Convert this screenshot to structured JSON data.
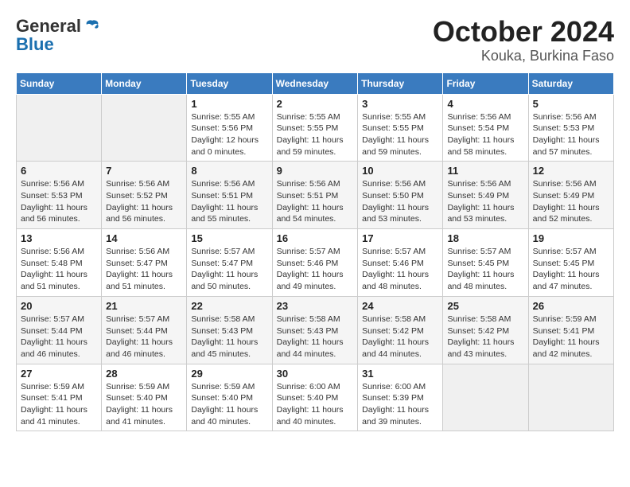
{
  "header": {
    "logo_line1": "General",
    "logo_line2": "Blue",
    "month": "October 2024",
    "location": "Kouka, Burkina Faso"
  },
  "weekdays": [
    "Sunday",
    "Monday",
    "Tuesday",
    "Wednesday",
    "Thursday",
    "Friday",
    "Saturday"
  ],
  "weeks": [
    [
      {
        "day": "",
        "info": ""
      },
      {
        "day": "",
        "info": ""
      },
      {
        "day": "1",
        "info": "Sunrise: 5:55 AM\nSunset: 5:56 PM\nDaylight: 12 hours\nand 0 minutes."
      },
      {
        "day": "2",
        "info": "Sunrise: 5:55 AM\nSunset: 5:55 PM\nDaylight: 11 hours\nand 59 minutes."
      },
      {
        "day": "3",
        "info": "Sunrise: 5:55 AM\nSunset: 5:55 PM\nDaylight: 11 hours\nand 59 minutes."
      },
      {
        "day": "4",
        "info": "Sunrise: 5:56 AM\nSunset: 5:54 PM\nDaylight: 11 hours\nand 58 minutes."
      },
      {
        "day": "5",
        "info": "Sunrise: 5:56 AM\nSunset: 5:53 PM\nDaylight: 11 hours\nand 57 minutes."
      }
    ],
    [
      {
        "day": "6",
        "info": "Sunrise: 5:56 AM\nSunset: 5:53 PM\nDaylight: 11 hours\nand 56 minutes."
      },
      {
        "day": "7",
        "info": "Sunrise: 5:56 AM\nSunset: 5:52 PM\nDaylight: 11 hours\nand 56 minutes."
      },
      {
        "day": "8",
        "info": "Sunrise: 5:56 AM\nSunset: 5:51 PM\nDaylight: 11 hours\nand 55 minutes."
      },
      {
        "day": "9",
        "info": "Sunrise: 5:56 AM\nSunset: 5:51 PM\nDaylight: 11 hours\nand 54 minutes."
      },
      {
        "day": "10",
        "info": "Sunrise: 5:56 AM\nSunset: 5:50 PM\nDaylight: 11 hours\nand 53 minutes."
      },
      {
        "day": "11",
        "info": "Sunrise: 5:56 AM\nSunset: 5:49 PM\nDaylight: 11 hours\nand 53 minutes."
      },
      {
        "day": "12",
        "info": "Sunrise: 5:56 AM\nSunset: 5:49 PM\nDaylight: 11 hours\nand 52 minutes."
      }
    ],
    [
      {
        "day": "13",
        "info": "Sunrise: 5:56 AM\nSunset: 5:48 PM\nDaylight: 11 hours\nand 51 minutes."
      },
      {
        "day": "14",
        "info": "Sunrise: 5:56 AM\nSunset: 5:47 PM\nDaylight: 11 hours\nand 51 minutes."
      },
      {
        "day": "15",
        "info": "Sunrise: 5:57 AM\nSunset: 5:47 PM\nDaylight: 11 hours\nand 50 minutes."
      },
      {
        "day": "16",
        "info": "Sunrise: 5:57 AM\nSunset: 5:46 PM\nDaylight: 11 hours\nand 49 minutes."
      },
      {
        "day": "17",
        "info": "Sunrise: 5:57 AM\nSunset: 5:46 PM\nDaylight: 11 hours\nand 48 minutes."
      },
      {
        "day": "18",
        "info": "Sunrise: 5:57 AM\nSunset: 5:45 PM\nDaylight: 11 hours\nand 48 minutes."
      },
      {
        "day": "19",
        "info": "Sunrise: 5:57 AM\nSunset: 5:45 PM\nDaylight: 11 hours\nand 47 minutes."
      }
    ],
    [
      {
        "day": "20",
        "info": "Sunrise: 5:57 AM\nSunset: 5:44 PM\nDaylight: 11 hours\nand 46 minutes."
      },
      {
        "day": "21",
        "info": "Sunrise: 5:57 AM\nSunset: 5:44 PM\nDaylight: 11 hours\nand 46 minutes."
      },
      {
        "day": "22",
        "info": "Sunrise: 5:58 AM\nSunset: 5:43 PM\nDaylight: 11 hours\nand 45 minutes."
      },
      {
        "day": "23",
        "info": "Sunrise: 5:58 AM\nSunset: 5:43 PM\nDaylight: 11 hours\nand 44 minutes."
      },
      {
        "day": "24",
        "info": "Sunrise: 5:58 AM\nSunset: 5:42 PM\nDaylight: 11 hours\nand 44 minutes."
      },
      {
        "day": "25",
        "info": "Sunrise: 5:58 AM\nSunset: 5:42 PM\nDaylight: 11 hours\nand 43 minutes."
      },
      {
        "day": "26",
        "info": "Sunrise: 5:59 AM\nSunset: 5:41 PM\nDaylight: 11 hours\nand 42 minutes."
      }
    ],
    [
      {
        "day": "27",
        "info": "Sunrise: 5:59 AM\nSunset: 5:41 PM\nDaylight: 11 hours\nand 41 minutes."
      },
      {
        "day": "28",
        "info": "Sunrise: 5:59 AM\nSunset: 5:40 PM\nDaylight: 11 hours\nand 41 minutes."
      },
      {
        "day": "29",
        "info": "Sunrise: 5:59 AM\nSunset: 5:40 PM\nDaylight: 11 hours\nand 40 minutes."
      },
      {
        "day": "30",
        "info": "Sunrise: 6:00 AM\nSunset: 5:40 PM\nDaylight: 11 hours\nand 40 minutes."
      },
      {
        "day": "31",
        "info": "Sunrise: 6:00 AM\nSunset: 5:39 PM\nDaylight: 11 hours\nand 39 minutes."
      },
      {
        "day": "",
        "info": ""
      },
      {
        "day": "",
        "info": ""
      }
    ]
  ]
}
